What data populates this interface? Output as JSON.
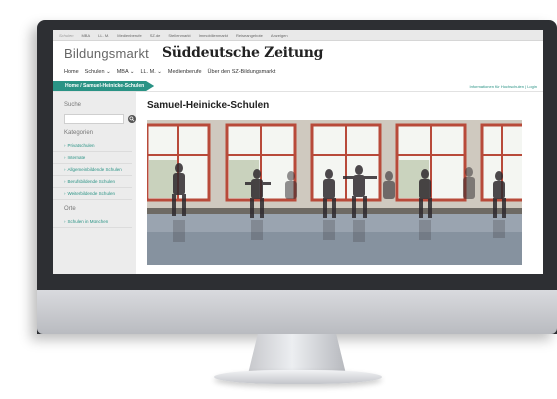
{
  "topbar": {
    "links": [
      "Schulen",
      "MBA",
      "LL. M.",
      "Medienberufe",
      "SZ.de",
      "Stellenmarkt",
      "Immobilienmarkt",
      "Reiseangebote",
      "Anzeigen"
    ]
  },
  "brand": {
    "section": "Bildungsmarkt",
    "logo": "Süddeutsche Zeitung"
  },
  "mainnav": {
    "items": [
      "Home",
      "Schulen",
      "MBA",
      "LL. M.",
      "Medienberufe",
      "Über den SZ-Bildungsmarkt"
    ]
  },
  "crumbbar": {
    "breadcrumb": "Home / Samuel-Heinicke-Schulen",
    "right_text": "Informationen für Hochschulen | Login"
  },
  "sidebar": {
    "search_label": "Suche",
    "categories_label": "Kategorien",
    "categories": [
      "Privatschulen",
      "Internate",
      "Allgemeinbildende Schulen",
      "Berufsbildende Schulen",
      "Weiterbildende Schulen"
    ],
    "places_label": "Orte",
    "places": [
      "Schulen in München"
    ]
  },
  "main": {
    "title": "Samuel-Heinicke-Schulen"
  },
  "colors": {
    "accent": "#2a9385",
    "bezel": "#2d2f33"
  }
}
